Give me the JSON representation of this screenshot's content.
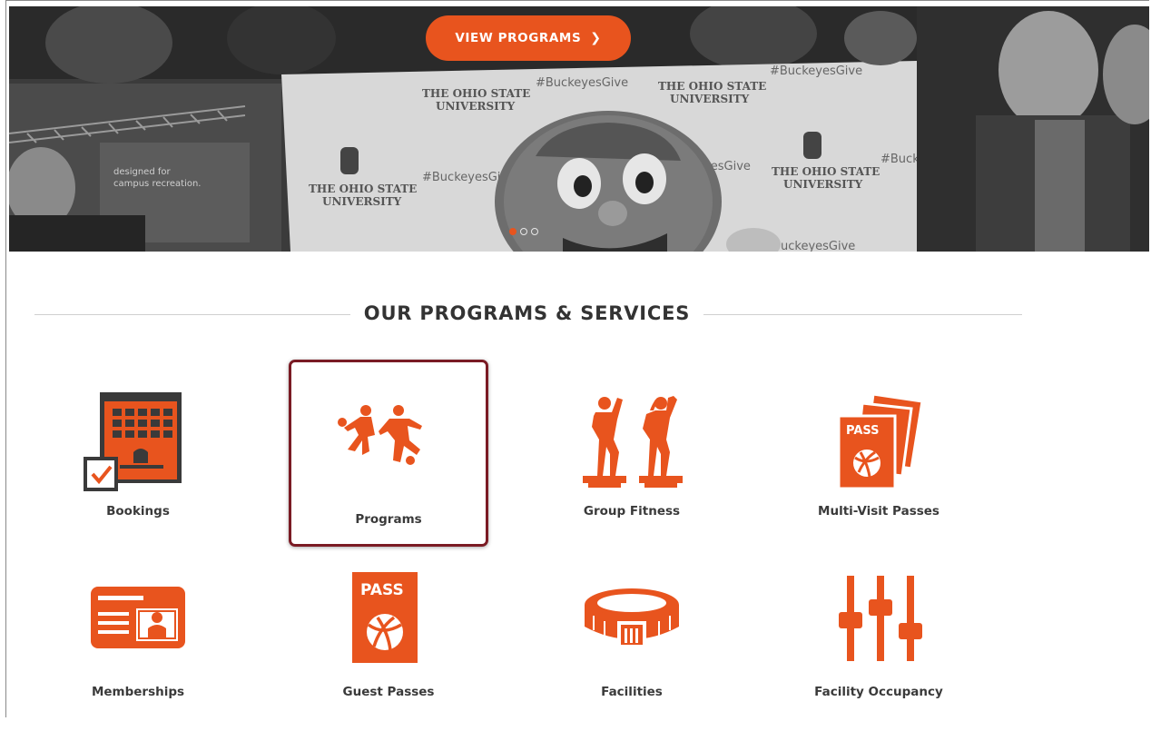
{
  "hero": {
    "cta_label": "VIEW PROGRAMS",
    "cta_icon": "chevron-right-icon",
    "banner_texts": {
      "university": "THE OHIO STATE UNIVERSITY",
      "hashtag": "#BuckeyesGive",
      "booth": "designed for campus recreation."
    },
    "carousel": {
      "slide_count": 3,
      "active_index": 0
    }
  },
  "section": {
    "title": "OUR PROGRAMS & SERVICES"
  },
  "services": [
    {
      "label": "Bookings",
      "icon": "calendar-building-icon",
      "selected": false
    },
    {
      "label": "Programs",
      "icon": "soccer-players-icon",
      "selected": true
    },
    {
      "label": "Group Fitness",
      "icon": "step-aerobics-icon",
      "selected": false
    },
    {
      "label": "Multi-Visit Passes",
      "icon": "pass-stack-icon",
      "selected": false,
      "icon_text": "PASS"
    },
    {
      "label": "Memberships",
      "icon": "id-card-icon",
      "selected": false
    },
    {
      "label": "Guest Passes",
      "icon": "pass-icon",
      "selected": false,
      "icon_text": "PASS"
    },
    {
      "label": "Facilities",
      "icon": "stadium-icon",
      "selected": false
    },
    {
      "label": "Facility Occupancy",
      "icon": "sliders-icon",
      "selected": false
    }
  ],
  "colors": {
    "accent": "#e8541e",
    "selected_border": "#7a1b24",
    "text": "#3a3a3a"
  }
}
